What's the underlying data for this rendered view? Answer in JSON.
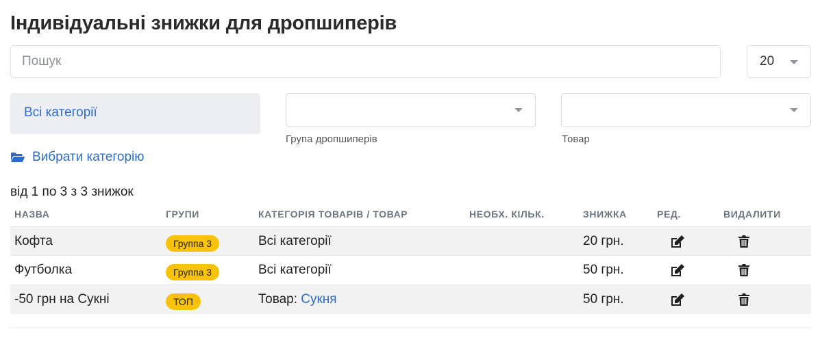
{
  "page": {
    "title": "Індивідуальні знижки для дропшиперів"
  },
  "search": {
    "placeholder": "Пошук",
    "value": ""
  },
  "per_page": {
    "value": "20"
  },
  "filters": {
    "category_box": "Всі категорії",
    "group_select": {
      "value": "",
      "label": "Група дропшиперів"
    },
    "product_select": {
      "value": "",
      "label": "Товар"
    },
    "choose_category": "Вибрати категорію"
  },
  "summary": "від 1 по 3 з 3 знижок",
  "table": {
    "headers": {
      "name": "НАЗВА",
      "groups": "ГРУПИ",
      "category": "КАТЕГОРІЯ ТОВАРІВ / ТОВАР",
      "qty": "НЕОБХ. КІЛЬК.",
      "discount": "ЗНИЖКА",
      "edit": "РЕД.",
      "delete": "ВИДАЛИТИ"
    },
    "rows": [
      {
        "name": "Кофта",
        "group": "Группа 3",
        "category_prefix": "Всі категорії",
        "category_link": "",
        "qty": "",
        "discount": "20 грн."
      },
      {
        "name": "Футболка",
        "group": "Группа 3",
        "category_prefix": "Всі категорії",
        "category_link": "",
        "qty": "",
        "discount": "50 грн."
      },
      {
        "name": "-50 грн на Сукні",
        "group": "ТОП",
        "category_prefix": "Товар: ",
        "category_link": "Сукня",
        "qty": "",
        "discount": "50 грн."
      }
    ]
  },
  "icons": {
    "folder": "folder-open-icon",
    "edit": "edit-icon",
    "delete": "trash-icon",
    "caret": "chevron-down-icon"
  },
  "colors": {
    "link": "#2d6ccf",
    "badge": "#f9c20a",
    "category_box_bg": "#eceef1",
    "row_stripe": "#f2f2f2"
  }
}
